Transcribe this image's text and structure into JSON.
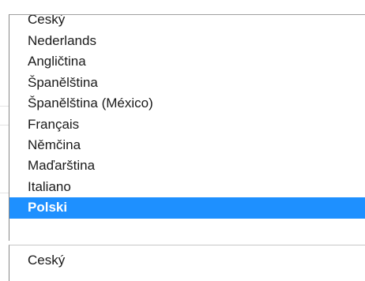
{
  "dropdown": {
    "options": [
      {
        "label": "Ceský"
      },
      {
        "label": "Nederlands"
      },
      {
        "label": "Angličtina"
      },
      {
        "label": "Španělština"
      },
      {
        "label": "Španělština (México)"
      },
      {
        "label": "Français"
      },
      {
        "label": "Němčina"
      },
      {
        "label": "Maďarština"
      },
      {
        "label": "Italiano"
      },
      {
        "label": "Polski"
      }
    ],
    "highlighted_label": "Polski",
    "highlight_color": "#1e90ff"
  },
  "select": {
    "current_value": "Ceský"
  }
}
